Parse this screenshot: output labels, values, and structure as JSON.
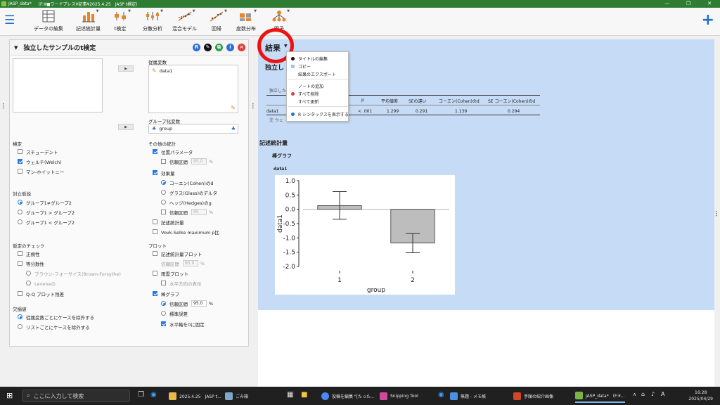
{
  "window": {
    "app_label": "JASP_data*",
    "doc_label": "(F:¥■ワードプレス¥記事¥2025.4.25　JASP t検定)"
  },
  "ribbon": {
    "items": [
      {
        "label": "データの編集",
        "icon": "table-icon",
        "caret": false
      },
      {
        "label": "記述統計量",
        "icon": "bar-chart-icon",
        "caret": true
      },
      {
        "label": "t検定",
        "icon": "t-test-icon",
        "caret": true
      },
      {
        "label": "分散分析",
        "icon": "anova-icon",
        "caret": true
      },
      {
        "label": "混合モデル",
        "icon": "mixed-model-icon",
        "caret": true
      },
      {
        "label": "回帰",
        "icon": "regression-icon",
        "caret": true
      },
      {
        "label": "度数分布",
        "icon": "frequency-icon",
        "caret": true
      },
      {
        "label": "因子",
        "icon": "factor-icon",
        "caret": true
      }
    ]
  },
  "panel": {
    "title": "独立したサンプルのt検定",
    "dependent_label": "従属変数",
    "dependent_items": [
      "data1"
    ],
    "grouping_label": "グループ化変数",
    "grouping_value": "group",
    "test_label": "検定",
    "tests": [
      {
        "label": "スチューデント",
        "checked": false
      },
      {
        "label": "ウェルチ(Welch)",
        "checked": true
      },
      {
        "label": "マン-ホイットニー",
        "checked": false
      }
    ],
    "alt_label": "対立仮説",
    "alts": [
      {
        "label": "グループ1≠グループ2",
        "selected": true
      },
      {
        "label": "グループ1 > グループ2",
        "selected": false
      },
      {
        "label": "グループ1 < グループ2",
        "selected": false
      }
    ],
    "assump_label": "仮定のチェック",
    "normality": "正規性",
    "equal_var": "等分散性",
    "brown": "ブラウン-フォーサイス(Brown-Forsythe)",
    "levene": "Leveneの",
    "qq": "Q-Q プロット残差",
    "missing_label": "欠損値",
    "missing1": "従属変数ごとにケースを除外する",
    "missing2": "リストごとにケースを除外する",
    "other_label": "その他の統計",
    "location": "位置パラメータ",
    "ci1": "信頼区間",
    "ci1_val": "95.0",
    "pct": "%",
    "effect": "効果量",
    "cohen": "コーエン(Cohen)のd",
    "glass": "グラス(Glass)のデルタ",
    "hedges": "ヘッジ(Hedges)のg",
    "ci2": "信頼区間",
    "ci2_val": "95",
    "descstat": "記述統計量",
    "vovk": "Vovk-Selke maximum p比",
    "plot_label": "プロット",
    "descplot": "記述統計量プロット",
    "ci3": "信頼区間",
    "ci3_val": "95.0",
    "rain": "雨雲プロット",
    "horiz": "水平方向の表示",
    "barplot": "棒グラフ",
    "ci4": "信頼区間",
    "ci4_val": "95.0",
    "se": "標準誤差",
    "zero": "水平軸を0に固定"
  },
  "results": {
    "title": "結果",
    "analysis_title": "独立し",
    "table_note": "独立した",
    "footnote": "注 ウェ",
    "columns": [
      "p",
      "平均値差",
      "SEの違い",
      "コーエン(Cohen)のd",
      "SE コーエン(Cohen)のd"
    ],
    "row": {
      "var": "data1",
      "p": "< .001",
      "mean_diff": "1.299",
      "se_diff": "0.291",
      "d": "1.139",
      "se_d": "0.294"
    },
    "desc_heading": "記述統計量",
    "bar_heading": "棒グラフ",
    "var_heading": "data1"
  },
  "menu": {
    "items": [
      {
        "label": "タイトルの編集",
        "icon": "black-dot"
      },
      {
        "label": "コピー",
        "icon": "copy-icon"
      },
      {
        "label": "結果のエクスポート",
        "icon": ""
      },
      {
        "label": "ノートの追加",
        "icon": ""
      },
      {
        "label": "すべて削除",
        "icon": "red-dot"
      },
      {
        "label": "すべて更新",
        "icon": ""
      },
      {
        "label": "R シンタックスを表示する",
        "icon": "blue-dot"
      }
    ]
  },
  "chart_data": {
    "type": "bar",
    "categories": [
      "1",
      "2"
    ],
    "values": [
      0.13,
      -1.18
    ],
    "error_low": [
      -0.35,
      -1.52
    ],
    "error_high": [
      0.62,
      -0.85
    ],
    "xlabel": "group",
    "ylabel": "data1",
    "ylim": [
      -2.0,
      1.0
    ],
    "yticks": [
      "1.0",
      "0.5",
      "0.0",
      "-0.5",
      "-1.0",
      "-1.5",
      "-2.0"
    ],
    "bar_color": "#bdbdbd"
  },
  "taskbar": {
    "search_placeholder": "ここに入力して検索",
    "items": [
      {
        "label": "2025.4.25　JASP t...",
        "color": "#e9b949"
      },
      {
        "label": "ごみ箱",
        "color": "#7fa7c9"
      },
      {
        "label": "投稿を編集 \"[たった...",
        "color": "#4a8af4"
      },
      {
        "label": "Snipping Tool",
        "color": "#d04a9b"
      },
      {
        "label": "無題 - メモ帳",
        "color": "#4a90e2"
      },
      {
        "label": "手順の紹介画像",
        "color": "#d24726"
      },
      {
        "label": "JASP_data*　(F:¥...",
        "color": "#7cb342"
      }
    ],
    "ime": "A",
    "time": "16:28",
    "date": "2025/04/29"
  },
  "colors": {
    "accent": "#1e6fd0",
    "results_bg": "#c6dbf5",
    "highlight_ring": "#e11111",
    "jasp_green": "#2e7d32"
  }
}
